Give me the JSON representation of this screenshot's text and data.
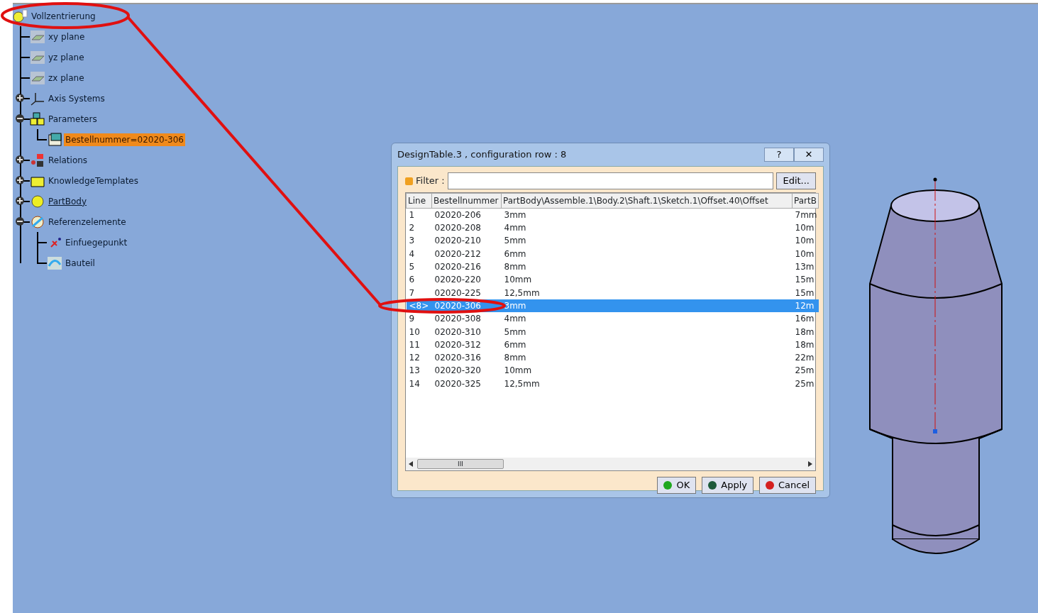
{
  "tree": {
    "label": "Vollzentrierung",
    "children": [
      {
        "label": "xy plane",
        "kind": "plane"
      },
      {
        "label": "yz plane",
        "kind": "plane"
      },
      {
        "label": "zx plane",
        "kind": "plane"
      },
      {
        "label": "Axis Systems",
        "kind": "axis",
        "expanded": false
      },
      {
        "label": "Parameters",
        "kind": "params",
        "expanded": true,
        "children": [
          {
            "label": "Bestellnummer=02020-306",
            "kind": "param",
            "selected": true
          }
        ]
      },
      {
        "label": "Relations",
        "kind": "relations",
        "expanded": false
      },
      {
        "label": "KnowledgeTemplates",
        "kind": "knowledge",
        "expanded": false
      },
      {
        "label": "PartBody",
        "kind": "body",
        "expanded": false,
        "in_work": true
      },
      {
        "label": "Referenzelemente",
        "kind": "refs",
        "expanded": true,
        "children": [
          {
            "label": "Einfuegepunkt",
            "kind": "point"
          },
          {
            "label": "Bauteil",
            "kind": "part"
          }
        ]
      }
    ]
  },
  "dialog": {
    "title": "DesignTable.3 , configuration row : 8",
    "help": "?",
    "close": "✕",
    "filter_label": "Filter :",
    "edit_button": "Edit...",
    "columns": [
      "Line",
      "Bestellnummer",
      "PartBody\\Assemble.1\\Body.2\\Shaft.1\\Sketch.1\\Offset.40\\Offset",
      "PartB"
    ],
    "rows": [
      {
        "cells": [
          "1",
          "02020-206",
          "3mm",
          "7mm"
        ],
        "selected": false
      },
      {
        "cells": [
          "2",
          "02020-208",
          "4mm",
          "10m"
        ],
        "selected": false
      },
      {
        "cells": [
          "3",
          "02020-210",
          "5mm",
          "10m"
        ],
        "selected": false
      },
      {
        "cells": [
          "4",
          "02020-212",
          "6mm",
          "10m"
        ],
        "selected": false
      },
      {
        "cells": [
          "5",
          "02020-216",
          "8mm",
          "13m"
        ],
        "selected": false
      },
      {
        "cells": [
          "6",
          "02020-220",
          "10mm",
          "15m"
        ],
        "selected": false
      },
      {
        "cells": [
          "7",
          "02020-225",
          "12,5mm",
          "15m"
        ],
        "selected": false
      },
      {
        "cells": [
          "<8>",
          "02020-306",
          "3mm",
          "12m"
        ],
        "selected": true
      },
      {
        "cells": [
          "9",
          "02020-308",
          "4mm",
          "16m"
        ],
        "selected": false
      },
      {
        "cells": [
          "10",
          "02020-310",
          "5mm",
          "18m"
        ],
        "selected": false
      },
      {
        "cells": [
          "11",
          "02020-312",
          "6mm",
          "18m"
        ],
        "selected": false
      },
      {
        "cells": [
          "12",
          "02020-316",
          "8mm",
          "22m"
        ],
        "selected": false
      },
      {
        "cells": [
          "13",
          "02020-320",
          "10mm",
          "25m"
        ],
        "selected": false
      },
      {
        "cells": [
          "14",
          "02020-325",
          "12,5mm",
          "25m"
        ],
        "selected": false
      }
    ],
    "scroll_grip": "III",
    "buttons": [
      {
        "label": "OK",
        "color": "#1fa81f"
      },
      {
        "label": "Apply",
        "color": "#1d5a3a"
      },
      {
        "label": "Cancel",
        "color": "#d42020"
      }
    ]
  }
}
